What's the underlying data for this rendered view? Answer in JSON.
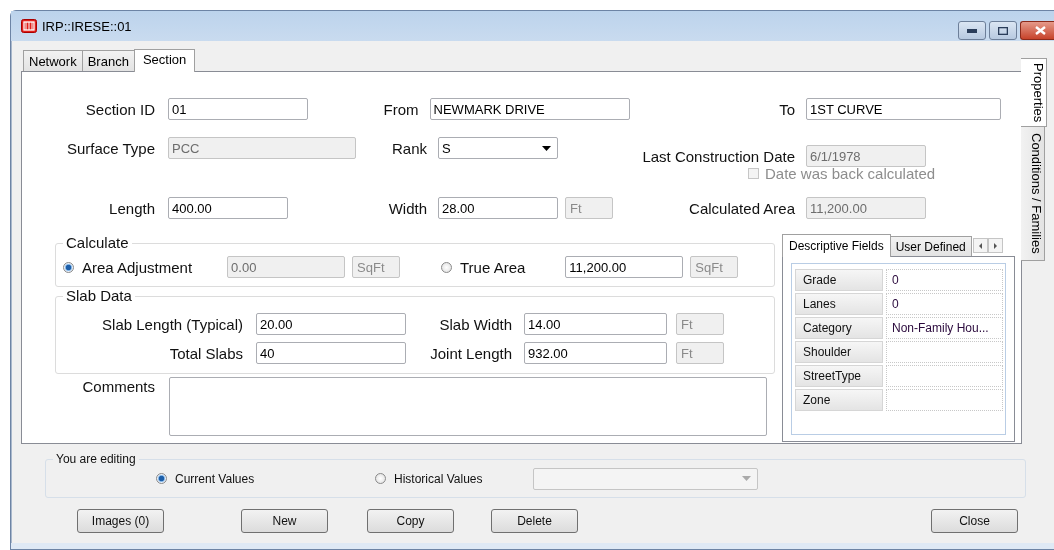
{
  "window": {
    "title": "IRP::IRESE::01"
  },
  "tabs": [
    {
      "label": "Network",
      "selected": false
    },
    {
      "label": "Branch",
      "selected": false
    },
    {
      "label": "Section",
      "selected": true
    }
  ],
  "side_tabs": [
    {
      "label": "Properties",
      "selected": true
    },
    {
      "label": "Conditions / Families",
      "selected": false
    }
  ],
  "field_rows": [
    [
      {
        "label": "Section ID",
        "value": "01",
        "kind": "text"
      },
      {
        "label": "From",
        "value": "NEWMARK DRIVE",
        "kind": "text"
      },
      {
        "label": "To",
        "value": "1ST CURVE",
        "kind": "text"
      }
    ],
    [
      {
        "label": "Surface Type",
        "value": "PCC",
        "kind": "readonly"
      },
      {
        "label": "Rank",
        "value": "S",
        "kind": "dropdown"
      },
      {
        "label": "Last Construction Date",
        "value": "6/1/1978",
        "kind": "readonly"
      }
    ],
    [
      {
        "label": "Length",
        "value": "400.00",
        "kind": "text"
      },
      {
        "label": "Width",
        "value": "28.00",
        "kind": "text",
        "unit": "Ft"
      },
      {
        "label": "Calculated Area",
        "value": "11,200.00",
        "kind": "readonly"
      }
    ]
  ],
  "back_calculated": {
    "label": "Date was back calculated",
    "checked": false,
    "disabled": true
  },
  "calculate": {
    "title": "Calculate",
    "options": [
      {
        "label": "Area Adjustment",
        "selected": true,
        "value": "0.00",
        "disabled": true,
        "unit": "SqFt"
      },
      {
        "label": "True Area",
        "selected": false,
        "value": "11,200.00",
        "disabled": false,
        "unit": "SqFt"
      }
    ]
  },
  "slab_data": {
    "title": "Slab Data",
    "fields": [
      {
        "label": "Slab Length (Typical)",
        "value": "20.00"
      },
      {
        "label": "Slab Width",
        "value": "14.00",
        "unit": "Ft"
      },
      {
        "label": "Total Slabs",
        "value": "40"
      },
      {
        "label": "Joint Length",
        "value": "932.00",
        "unit": "Ft"
      }
    ]
  },
  "comments": {
    "label": "Comments"
  },
  "descriptive": {
    "tabs": [
      {
        "label": "Descriptive Fields",
        "selected": true
      },
      {
        "label": "User Defined",
        "selected": false
      }
    ],
    "rows": [
      {
        "name": "Grade",
        "value": "0"
      },
      {
        "name": "Lanes",
        "value": "0"
      },
      {
        "name": "Category",
        "value": "Non-Family Hou..."
      },
      {
        "name": "Shoulder"
      },
      {
        "name": "StreetType"
      },
      {
        "name": "Zone"
      }
    ]
  },
  "editing": {
    "title": "You are editing",
    "options": [
      {
        "label": "Current Values",
        "selected": true
      },
      {
        "label": "Historical Values",
        "selected": false
      }
    ]
  },
  "buttons": [
    "Images (0)",
    "New",
    "Copy",
    "Delete",
    "Close"
  ]
}
